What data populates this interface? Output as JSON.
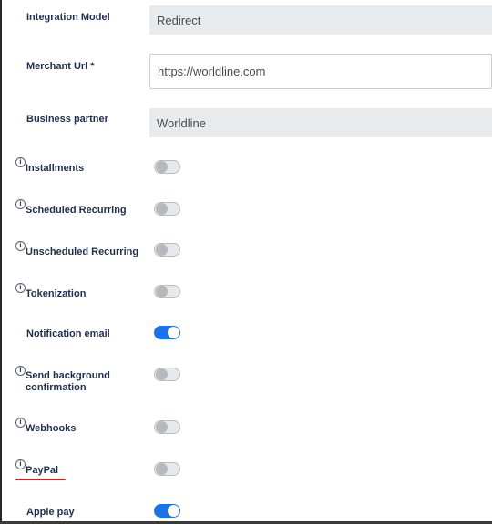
{
  "fields": {
    "integration_model": {
      "label": "Integration Model",
      "value": "Redirect"
    },
    "merchant_url": {
      "label": "Merchant Url *",
      "value": "https://worldline.com"
    },
    "business_partner": {
      "label": "Business partner",
      "value": "Worldline"
    }
  },
  "info_icon_glyph": "i",
  "toggles": {
    "installments": {
      "label": "Installments",
      "on": false
    },
    "scheduled_recurring": {
      "label": "Scheduled Recurring",
      "on": false
    },
    "unscheduled_recurring": {
      "label": "Unscheduled Recurring",
      "on": false
    },
    "tokenization": {
      "label": "Tokenization",
      "on": false
    },
    "notification_email": {
      "label": "Notification email",
      "on": true
    },
    "send_background_confirmation": {
      "label_line1": "Send background",
      "label_line2": "confirmation",
      "on": false
    },
    "webhooks": {
      "label": "Webhooks",
      "on": false
    },
    "paypal": {
      "label": "PayPal",
      "on": false
    },
    "apple_pay": {
      "label": "Apple pay",
      "on": true
    }
  },
  "colors": {
    "toggle_on": "#1a73e8",
    "toggle_off": "#e6e8ea",
    "label_text": "#1f2e4d",
    "highlight_underline": "#e0171b"
  }
}
